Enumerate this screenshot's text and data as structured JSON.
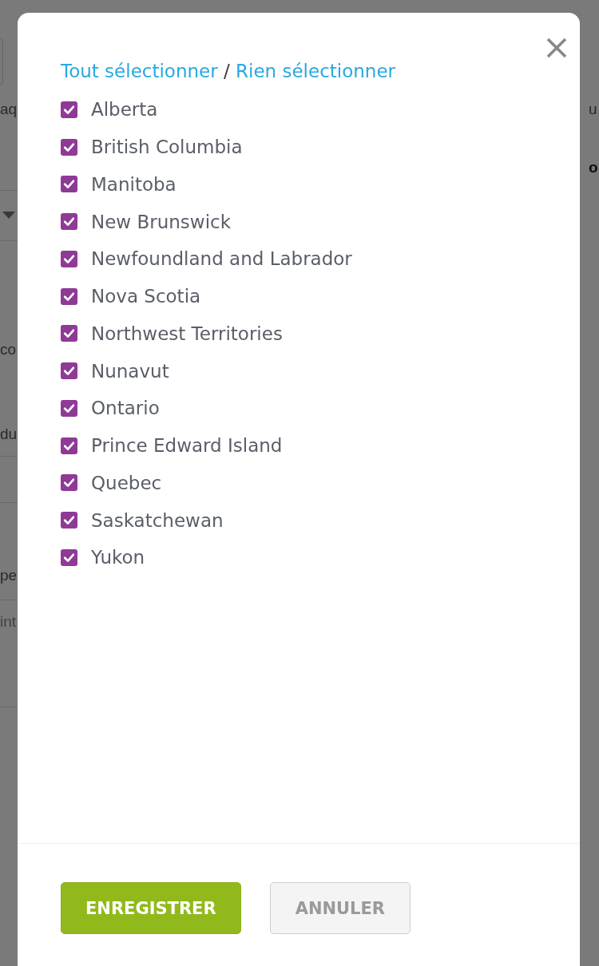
{
  "background": {
    "left_texts": [
      {
        "text": "aq",
        "kind": "label"
      },
      {
        "text": "co",
        "kind": "label"
      },
      {
        "text": "du",
        "kind": "label"
      },
      {
        "text": "pe",
        "kind": "label"
      },
      {
        "text": "int",
        "kind": "placeholder"
      }
    ],
    "right_texts": [
      {
        "text": "u",
        "kind": "label"
      },
      {
        "text": "o",
        "kind": "heading"
      }
    ]
  },
  "dialog": {
    "select_all_link": "Tout sélectionner",
    "separator": "/",
    "select_none_link": "Rien sélectionner",
    "provinces": [
      {
        "label": "Alberta",
        "checked": true
      },
      {
        "label": "British Columbia",
        "checked": true
      },
      {
        "label": "Manitoba",
        "checked": true
      },
      {
        "label": "New Brunswick",
        "checked": true
      },
      {
        "label": "Newfoundland and Labrador",
        "checked": true
      },
      {
        "label": "Nova Scotia",
        "checked": true
      },
      {
        "label": "Northwest Territories",
        "checked": true
      },
      {
        "label": "Nunavut",
        "checked": true
      },
      {
        "label": "Ontario",
        "checked": true
      },
      {
        "label": "Prince Edward Island",
        "checked": true
      },
      {
        "label": "Quebec",
        "checked": true
      },
      {
        "label": "Saskatchewan",
        "checked": true
      },
      {
        "label": "Yukon",
        "checked": true
      }
    ],
    "buttons": [
      {
        "label": "ENREGISTRER",
        "kind": "primary"
      },
      {
        "label": "ANNULER",
        "kind": "secondary"
      }
    ]
  }
}
